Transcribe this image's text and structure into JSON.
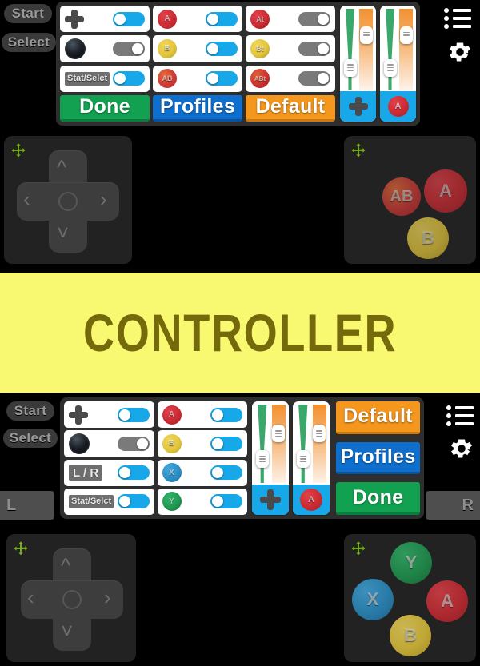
{
  "app": {
    "title": "CONTROLLER",
    "banner_bg": "#f9f871",
    "banner_text_color": "#746a0b",
    "accent_blue": "#16a8e8",
    "green": "#12a150",
    "blue": "#0f6fce",
    "orange": "#f5971d",
    "panel_bg": "#2e2e2e",
    "widget_bg": "#222222",
    "move_handle_color": "#7cb518"
  },
  "top_screen": {
    "side_buttons": [
      {
        "label": "Start",
        "name": "start-button"
      },
      {
        "label": "Select",
        "name": "select-button"
      }
    ],
    "config_rows": [
      [
        {
          "icon": "dpad-icon",
          "label": "",
          "type": "dpad",
          "toggle": "on"
        },
        {
          "icon": "a-button-icon",
          "label": "A",
          "type": "round-a",
          "toggle": "on"
        },
        {
          "icon": "at-button-icon",
          "label": "At",
          "type": "round-at",
          "toggle": "off"
        }
      ],
      [
        {
          "icon": "joystick-icon",
          "label": "",
          "type": "stick",
          "toggle": "off"
        },
        {
          "icon": "b-button-icon",
          "label": "B",
          "type": "round-b",
          "toggle": "on"
        },
        {
          "icon": "bt-button-icon",
          "label": "Bt",
          "type": "round-bt",
          "toggle": "off"
        }
      ],
      [
        {
          "icon": "chip-icon",
          "label": "Stat/Selct",
          "type": "chip",
          "toggle": "on"
        },
        {
          "icon": "ab-button-icon",
          "label": "AB",
          "type": "round-ab",
          "toggle": "on"
        },
        {
          "icon": "abt-button-icon",
          "label": "ABt",
          "type": "round-abt",
          "toggle": "off"
        }
      ]
    ],
    "action_buttons": [
      {
        "label": "Done",
        "style": "done"
      },
      {
        "label": "Profiles",
        "style": "profiles"
      },
      {
        "label": "Default",
        "style": "default"
      }
    ],
    "sliders": [
      {
        "name": "dpad-size-opacity-slider",
        "footer_icon": "dpad-icon",
        "footer_label": ""
      },
      {
        "name": "a-button-size-opacity-slider",
        "footer_icon": "a-button-icon",
        "footer_label": "A"
      }
    ],
    "menu_icon": "list-menu-icon",
    "settings_icon": "gear-icon"
  },
  "top_preview": {
    "dpad_widget": {
      "name": "dpad-widget",
      "move_icon": "move-handle-icon",
      "directions": [
        "up",
        "left",
        "right",
        "down"
      ]
    },
    "buttons_widget": {
      "name": "buttons-widget",
      "buttons": [
        {
          "label": "AB",
          "style": "ab"
        },
        {
          "label": "A",
          "style": "a"
        },
        {
          "label": "B",
          "style": "b"
        }
      ],
      "move_icon": "move-handle-icon"
    }
  },
  "bottom_screen": {
    "side_buttons": [
      {
        "label": "Start",
        "name": "start-button"
      },
      {
        "label": "Select",
        "name": "select-button"
      }
    ],
    "shoulder_buttons": [
      {
        "label": "L",
        "name": "shoulder-left-button"
      },
      {
        "label": "R",
        "name": "shoulder-right-button"
      }
    ],
    "config_rows": [
      [
        {
          "icon": "dpad-icon",
          "label": "",
          "type": "dpad",
          "toggle": "on"
        },
        {
          "icon": "a-button-icon",
          "label": "A",
          "type": "round-a",
          "toggle": "on"
        }
      ],
      [
        {
          "icon": "joystick-icon",
          "label": "",
          "type": "stick",
          "toggle": "off"
        },
        {
          "icon": "b-button-icon",
          "label": "B",
          "type": "round-b",
          "toggle": "on"
        }
      ],
      [
        {
          "icon": "chip-icon",
          "label": "L / R",
          "type": "chip",
          "toggle": "on"
        },
        {
          "icon": "x-button-icon",
          "label": "X",
          "type": "round-x",
          "toggle": "on"
        }
      ],
      [
        {
          "icon": "chip-icon",
          "label": "Stat/Selct",
          "type": "chip",
          "toggle": "on"
        },
        {
          "icon": "y-button-icon",
          "label": "Y",
          "type": "round-y",
          "toggle": "on"
        }
      ]
    ],
    "sliders": [
      {
        "name": "dpad-size-opacity-slider",
        "footer_icon": "dpad-icon",
        "footer_label": ""
      },
      {
        "name": "a-button-size-opacity-slider",
        "footer_icon": "a-button-icon",
        "footer_label": "A"
      }
    ],
    "action_buttons": [
      {
        "label": "Default",
        "style": "default"
      },
      {
        "label": "Profiles",
        "style": "profiles"
      },
      {
        "label": "Done",
        "style": "done"
      }
    ],
    "menu_icon": "list-menu-icon",
    "settings_icon": "gear-icon"
  },
  "bottom_preview": {
    "dpad_widget": {
      "name": "dpad-widget",
      "move_icon": "move-handle-icon"
    },
    "buttons_widget": {
      "name": "buttons-widget",
      "buttons": [
        {
          "label": "Y",
          "style": "y"
        },
        {
          "label": "X",
          "style": "x"
        },
        {
          "label": "A",
          "style": "a"
        },
        {
          "label": "B",
          "style": "b"
        }
      ],
      "move_icon": "move-handle-icon"
    }
  }
}
